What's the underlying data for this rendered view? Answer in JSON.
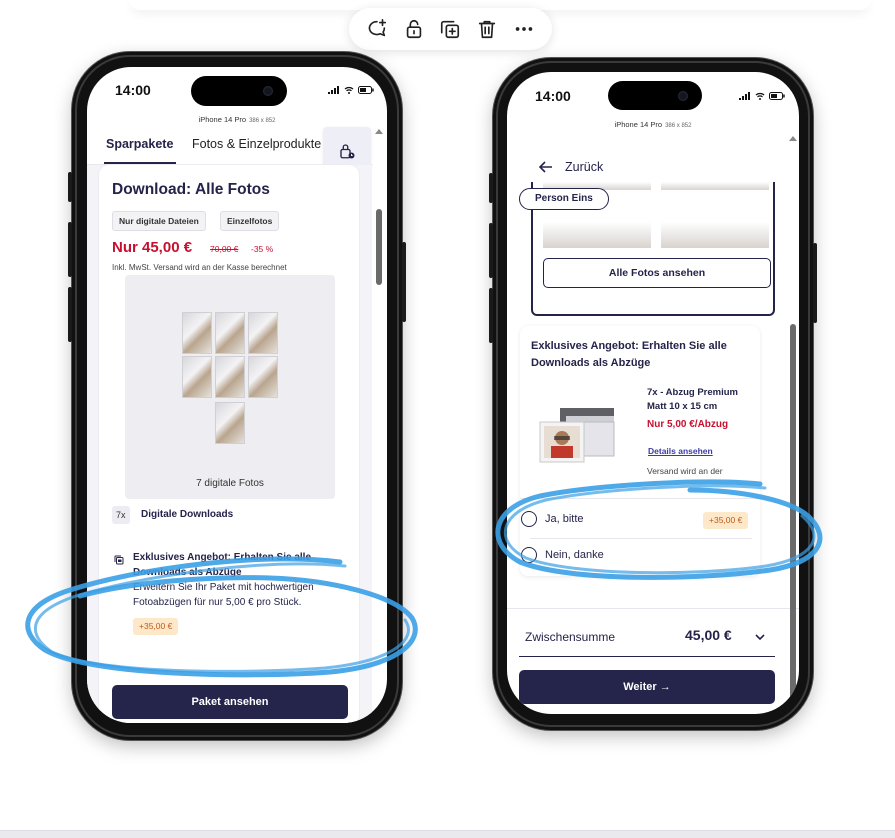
{
  "toolbar": {
    "icons": [
      "comment-add-icon",
      "unlock-icon",
      "duplicate-icon",
      "trash-icon",
      "more-icon"
    ]
  },
  "colors": {
    "brand_dark": "#24234a",
    "price_red": "#c8102e",
    "annotation_blue": "#3aa0e6",
    "badge_bg": "#fde9c9"
  },
  "left_phone": {
    "time": "14:00",
    "model": "iPhone 14 Pro",
    "model_size": "386 x 852",
    "tabs": [
      "Sparpakete",
      "Fotos & Einzelprodukte"
    ],
    "card": {
      "title": "Download: Alle Fotos",
      "chips": [
        "Nur digitale Dateien",
        "Einzelfotos"
      ],
      "price": "Nur 45,00 €",
      "old_price": "70,00 €",
      "discount": "-35 %",
      "tax_note": "Inkl. MwSt. Versand wird an der Kasse berechnet",
      "preview_caption": "7 digitale Fotos",
      "qty": "7x",
      "downloads_label": "Digitale Downloads",
      "offer_title": "Exklusives Angebot: Erhalten Sie alle Downloads als Abzüge",
      "offer_desc": "Erweitern Sie Ihr Paket mit hochwertigen Fotoabzügen für nur 5,00 € pro Stück.",
      "offer_badge": "+35,00 €",
      "cta": "Paket ansehen"
    }
  },
  "right_phone": {
    "time": "14:00",
    "model": "iPhone 14 Pro",
    "model_size": "386 x 852",
    "back_label": "Zurück",
    "person_pill": "Person Eins",
    "view_all": "Alle Fotos ansehen",
    "offer": {
      "title": "Exklusives Angebot: Erhalten Sie alle Downloads als Abzüge",
      "product_title": "7x - Abzug Premium Matt 10 x 15 cm",
      "product_price": "Nur 5,00 €/Abzug",
      "details_link": "Details ansehen",
      "shipping_note": "Versand wird an der",
      "option_yes": "Ja, bitte",
      "option_yes_badge": "+35,00 €",
      "option_no": "Nein, danke"
    },
    "subtotal_label": "Zwischensumme",
    "subtotal_value": "45,00 €",
    "cta": "Weiter →"
  }
}
